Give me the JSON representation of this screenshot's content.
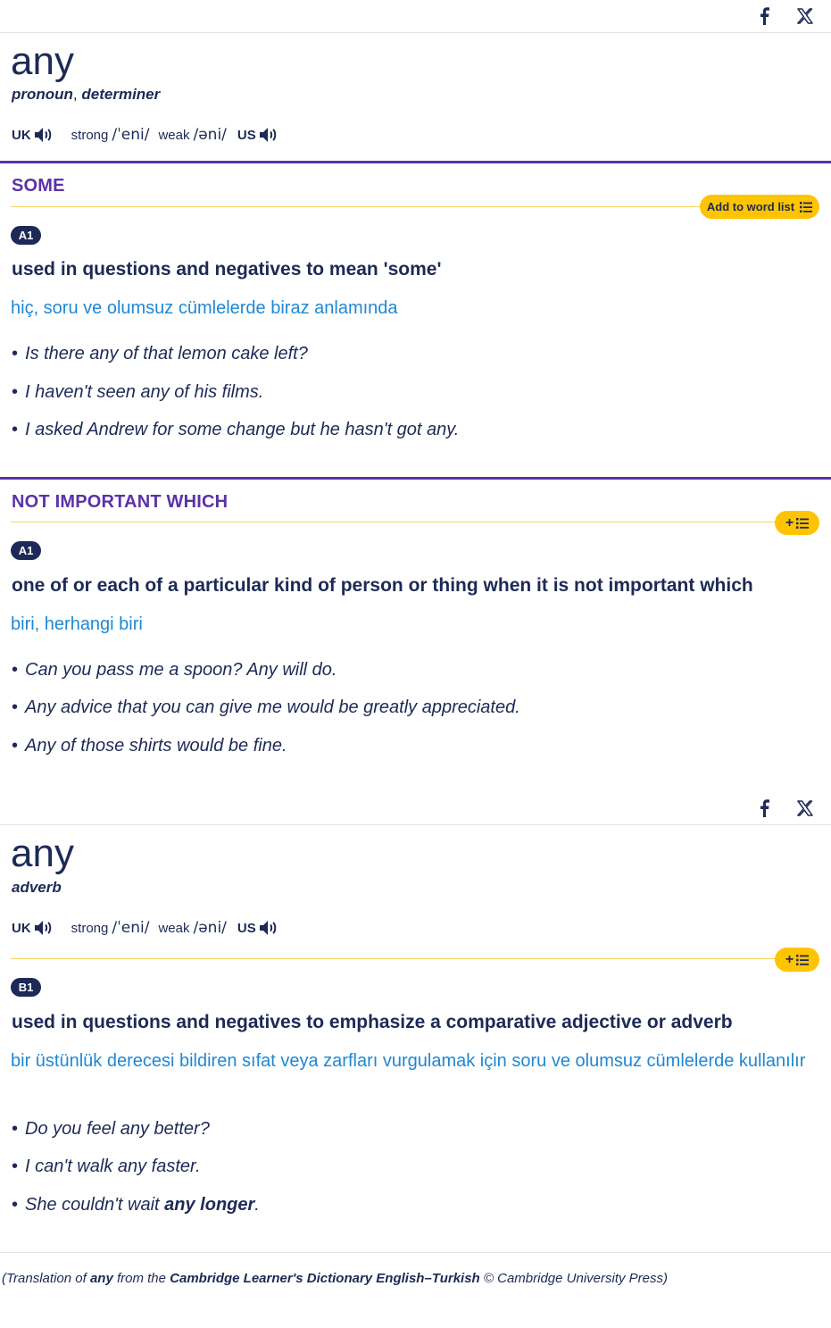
{
  "entries": [
    {
      "headword": "any",
      "pos": "pronoun",
      "pos_sep": ",",
      "pos2": "determiner",
      "pron": {
        "uk_label": "UK",
        "us_label": "US",
        "strong_label": "strong",
        "strong_ipa": "/ˈeni/",
        "weak_label": "weak",
        "weak_ipa": "/əni/"
      },
      "senses": [
        {
          "heading": "SOME",
          "wordlist_label": "Add to word list",
          "level": "A1",
          "definition": "used in questions and negatives to mean 'some'",
          "translation": "hiç, soru ve olumsuz cümlelerde biraz anlamında",
          "examples": [
            "Is there any of that lemon cake left?",
            "I haven't seen any of his films.",
            "I asked Andrew for some change but he hasn't got any."
          ]
        },
        {
          "heading": "NOT IMPORTANT WHICH",
          "wordlist_label": "+",
          "level": "A1",
          "definition": "one of or each of a particular kind of person or thing when it is not important which",
          "translation": "biri, herhangi biri",
          "examples": [
            "Can you pass me a spoon? Any will do.",
            "Any advice that you can give me would be greatly appreciated.",
            "Any of those shirts would be fine."
          ]
        }
      ]
    },
    {
      "headword": "any",
      "pos": "adverb",
      "pron": {
        "uk_label": "UK",
        "us_label": "US",
        "strong_label": "strong",
        "strong_ipa": "/ˈeni/",
        "weak_label": "weak",
        "weak_ipa": "/əni/"
      },
      "senses": [
        {
          "wordlist_label": "+",
          "level": "B1",
          "definition": "used in questions and negatives to emphasize a comparative adjective or adverb",
          "translation": "bir üstünlük derecesi bildiren sıfat veya zarfları vurgulamak için soru ve olumsuz cümlelerde kullanılır",
          "examples": [
            "Do you feel any better?",
            "I can't walk any faster.",
            "She couldn't wait "
          ],
          "example_bold": "any longer",
          "example_tail": "."
        }
      ]
    }
  ],
  "bullet": "•",
  "share": {
    "facebook_icon": "facebook-icon",
    "x_icon": "x-icon"
  },
  "credit": {
    "p1": "(Translation of ",
    "word": "any",
    "p2": " from the ",
    "book": "Cambridge Learner's Dictionary English–Turkish",
    "p3": " © Cambridge University Press)"
  },
  "colors": {
    "navy": "#1d2a57",
    "purple": "#5b32a8",
    "blue": "#1e88d4",
    "yellow": "#fec400"
  }
}
